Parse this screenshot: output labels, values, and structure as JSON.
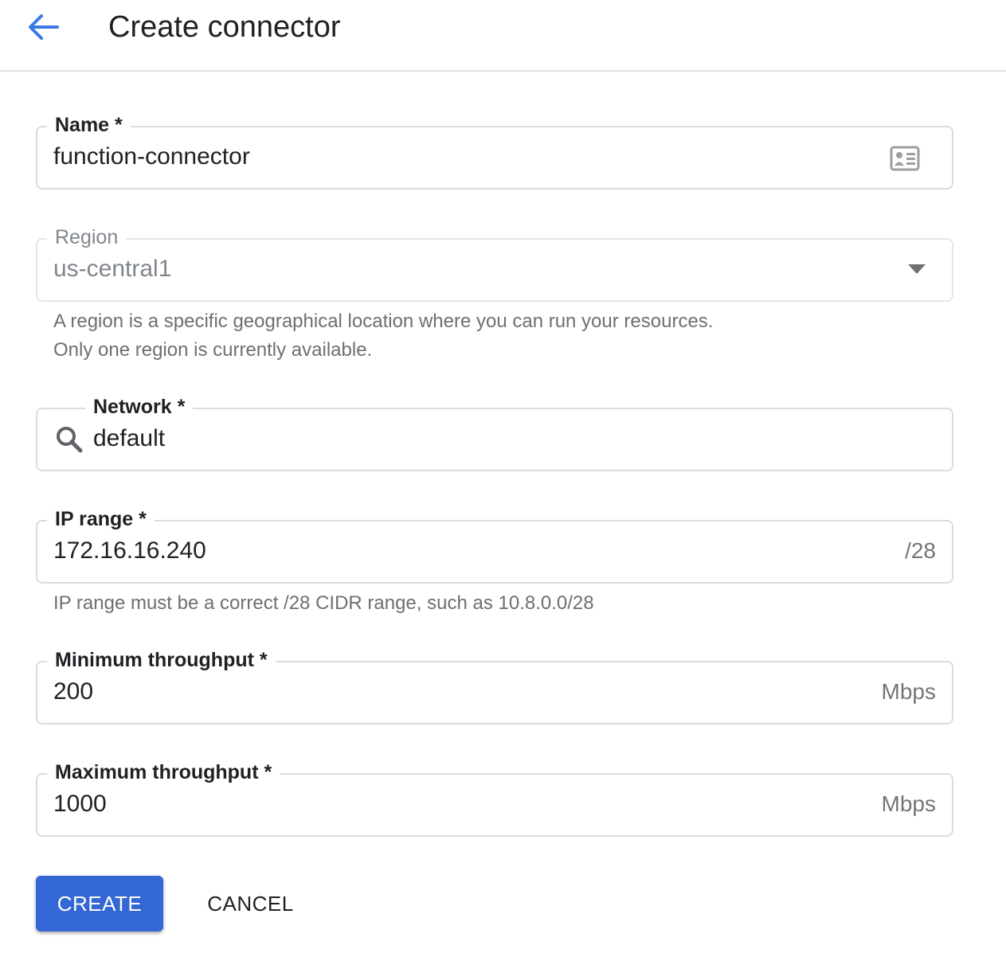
{
  "header": {
    "title": "Create connector",
    "back_icon": "arrow-back-icon",
    "accent_color": "#3b78e7"
  },
  "form": {
    "name": {
      "label": "Name *",
      "value": "function-connector",
      "icon": "contact-card-icon"
    },
    "region": {
      "label": "Region",
      "value": "us-central1",
      "icon": "dropdown-arrow-icon",
      "hint_line1": "A region is a specific geographical location where you can run your resources.",
      "hint_line2": "Only one region is currently available."
    },
    "network": {
      "label": "Network *",
      "value": "default",
      "icon": "search-icon"
    },
    "ip_range": {
      "label": "IP range *",
      "value": "172.16.16.240",
      "suffix": "/28",
      "hint": "IP range must be a correct /28 CIDR range, such as 10.8.0.0/28"
    },
    "min_throughput": {
      "label": "Minimum throughput *",
      "value": "200",
      "suffix": "Mbps"
    },
    "max_throughput": {
      "label": "Maximum throughput *",
      "value": "1000",
      "suffix": "Mbps"
    }
  },
  "actions": {
    "create_label": "CREATE",
    "cancel_label": "CANCEL",
    "create_color": "#3367d6"
  }
}
